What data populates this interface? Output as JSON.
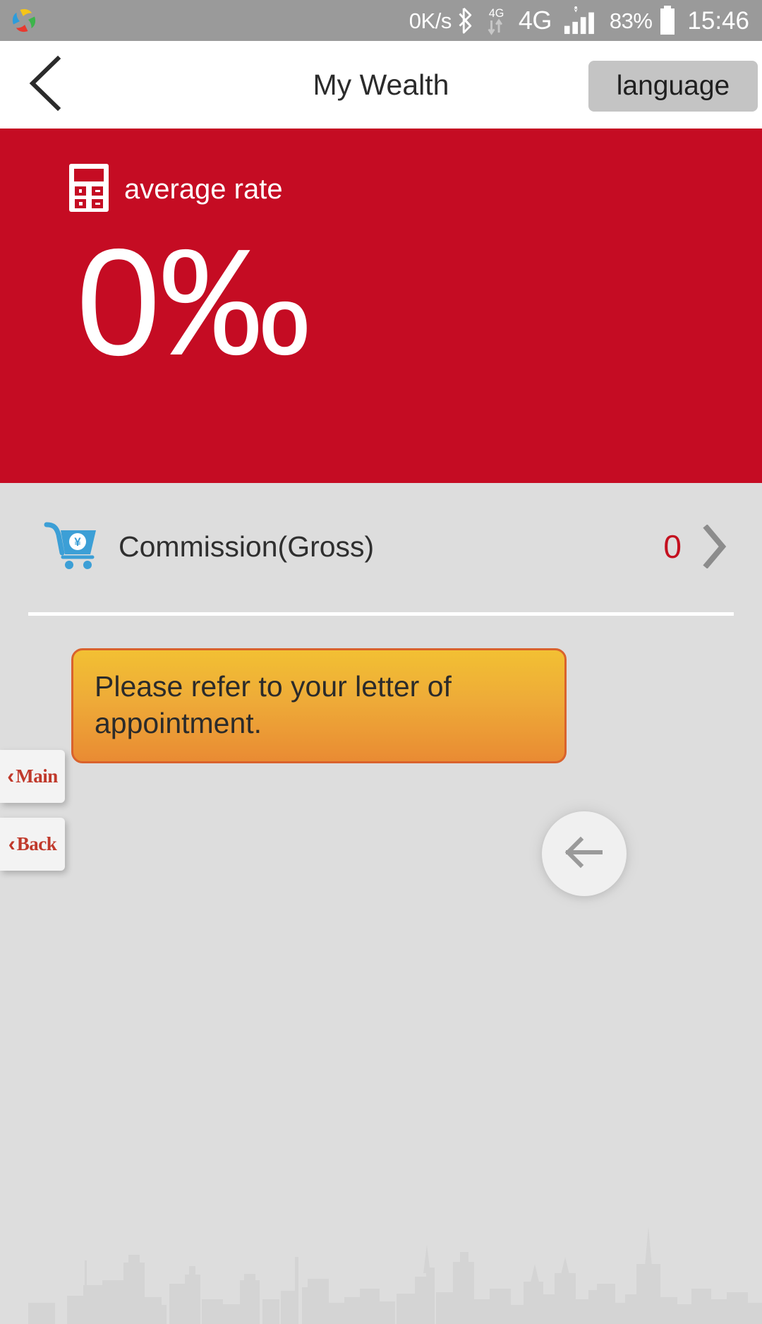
{
  "status_bar": {
    "app_icon": "pinwheel-app-icon",
    "network_speed": "0K/s",
    "bluetooth_icon": "bluetooth-icon",
    "data_icon_label": "4G",
    "network_label": "4G",
    "signal_icon": "signal-bars-icon",
    "battery_percent": "83%",
    "battery_icon": "battery-icon",
    "clock": "15:46",
    "background_color": "#9a9a9a",
    "text_color": "#ffffff"
  },
  "header": {
    "back_icon": "chevron-left-icon",
    "title": "My Wealth",
    "language_label": "language",
    "background_color": "#ffffff"
  },
  "hero": {
    "icon": "calculator-icon",
    "label": "average rate",
    "value": "0‰",
    "background_color": "#c50c23",
    "text_color": "#ffffff"
  },
  "commission": {
    "icon": "shopping-cart-yen-icon",
    "label": "Commission(Gross)",
    "value": "0",
    "value_color": "#c4101f",
    "chevron_icon": "chevron-right-icon"
  },
  "notice": {
    "text": "Please refer to your letter of appointment.",
    "gradient_from": "#f2c033",
    "gradient_to": "#e98b33",
    "border_color": "#d9622c"
  },
  "side_tabs": [
    {
      "chevron": "‹",
      "label": "Main",
      "name": "side-tab-main"
    },
    {
      "chevron": "‹",
      "label": "Back",
      "name": "side-tab-back"
    }
  ],
  "fab": {
    "icon": "arrow-left-icon",
    "background_color": "#f0f0f0",
    "icon_color": "#9a9a9a"
  },
  "background": {
    "page_color": "#dddddd",
    "skyline_color": "#d3d3d3"
  }
}
